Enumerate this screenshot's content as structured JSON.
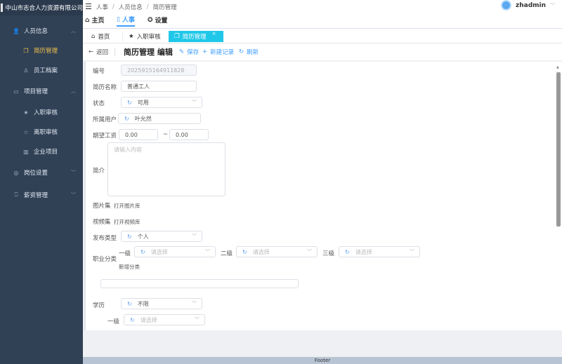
{
  "sidebar": {
    "company": "中山市志合人力资源有限公司",
    "items": [
      {
        "label": "人员信息",
        "icon": "user-icon"
      },
      {
        "label": "简历管理",
        "icon": "copy-icon"
      },
      {
        "label": "员工档案",
        "icon": "user-icon"
      },
      {
        "label": "项目管理",
        "icon": "card-icon"
      },
      {
        "label": "入职审核",
        "icon": "star-icon"
      },
      {
        "label": "离职审核",
        "icon": "star-outline-icon"
      },
      {
        "label": "企业项目",
        "icon": "building-icon"
      },
      {
        "label": "岗位设置",
        "icon": "gear-icon"
      },
      {
        "label": "薪资管理",
        "icon": "bag-icon"
      }
    ]
  },
  "header": {
    "breadcrumb": [
      "人事",
      "人员信息",
      "简历管理"
    ],
    "nav": [
      "主页",
      "人事",
      "设置"
    ],
    "user": "zhadmin"
  },
  "tags": [
    "首页",
    "入职审核",
    "简历管理"
  ],
  "page": {
    "back": "返回",
    "title": "简历管理 编辑",
    "save": "保存",
    "new": "新建记录",
    "refresh": "刷新"
  },
  "form": {
    "id_label": "编号",
    "id_value": "2025915164911828",
    "name_label": "简历名称",
    "name_value": "普通工人",
    "status_label": "状态",
    "status_value": "可用",
    "user_label": "所属用户",
    "user_value": "叶允然",
    "salary_label": "期望工资",
    "salary_min": "0.00",
    "salary_sep": "~",
    "salary_max": "0.00",
    "intro_label": "简介",
    "intro_placeholder": "请输入内容",
    "images_label": "图片集",
    "images_link": "打开图片库",
    "videos_label": "视频集",
    "videos_link": "打开视频库",
    "pubtype_label": "发布类型",
    "pubtype_value": "个人",
    "category_label": "职业分类",
    "level1": "一级",
    "level2": "二级",
    "level3": "三级",
    "select_placeholder": "请选择",
    "add_category": "新增分类",
    "edu_label": "学历",
    "edu_value": "不限",
    "edu_level1": "一级"
  },
  "footer": "Footer"
}
